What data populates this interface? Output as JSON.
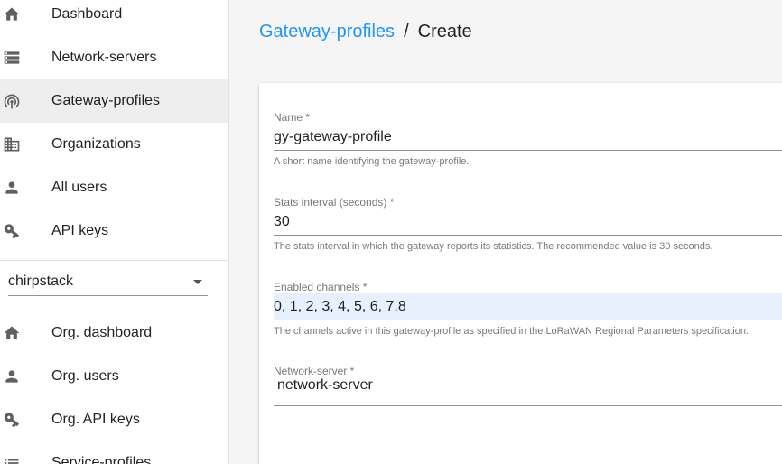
{
  "sidebar": {
    "items": [
      {
        "label": "Dashboard",
        "icon": "home-icon"
      },
      {
        "label": "Network-servers",
        "icon": "server-icon"
      },
      {
        "label": "Gateway-profiles",
        "icon": "radio-tower-icon",
        "selected": true
      },
      {
        "label": "Organizations",
        "icon": "domain-icon"
      },
      {
        "label": "All users",
        "icon": "person-icon"
      },
      {
        "label": "API keys",
        "icon": "key-icon"
      }
    ],
    "org_select": {
      "value": "chirpstack"
    },
    "org_items": [
      {
        "label": "Org. dashboard",
        "icon": "home-icon"
      },
      {
        "label": "Org. users",
        "icon": "person-icon"
      },
      {
        "label": "Org. API keys",
        "icon": "key-icon"
      },
      {
        "label": "Service-profiles",
        "icon": "list-icon"
      }
    ]
  },
  "breadcrumb": {
    "link": "Gateway-profiles",
    "separator": "/",
    "current": "Create"
  },
  "form": {
    "name": {
      "label": "Name *",
      "value": "gy-gateway-profile",
      "help": "A short name identifying the gateway-profile."
    },
    "stats_interval": {
      "label": "Stats interval (seconds) *",
      "value": "30",
      "help": "The stats interval in which the gateway reports its statistics. The recommended value is 30 seconds."
    },
    "channels": {
      "label": "Enabled channels *",
      "value": "0, 1, 2, 3, 4, 5, 6, 7,8",
      "help": "The channels active in this gateway-profile as specified in the LoRaWAN Regional Parameters specification."
    },
    "network_server": {
      "label": "Network-server *",
      "value": "network-server"
    }
  },
  "colors": {
    "accent": "#2196f3",
    "selected_bg": "#eeeeee",
    "autofill_bg": "#e8f0fe"
  }
}
